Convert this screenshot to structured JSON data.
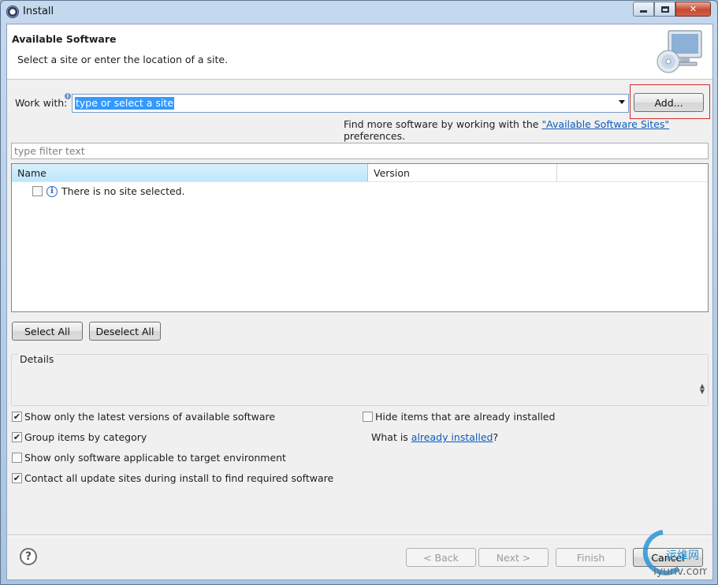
{
  "window": {
    "title": "Install",
    "controls": {
      "minimize": "minimize-icon",
      "maximize": "maximize-icon",
      "close": "close-icon"
    }
  },
  "header": {
    "title": "Available Software",
    "subtitle": "Select a site or enter the location of a site."
  },
  "work_with": {
    "label": "Work with:",
    "value": "type or select a site",
    "add_label": "Add..."
  },
  "find_more": {
    "prefix": "Find more software by working with the ",
    "link": "\"Available Software Sites\"",
    "suffix": " preferences."
  },
  "filter": {
    "placeholder": "type filter text"
  },
  "table": {
    "columns": [
      "Name",
      "Version"
    ],
    "rows": [
      {
        "label": "There is no site selected.",
        "checked": false
      }
    ]
  },
  "buttons": {
    "select_all": "Select All",
    "deselect_all": "Deselect All",
    "back": "< Back",
    "next": "Next >",
    "finish": "Finish",
    "cancel": "Cancel"
  },
  "details": {
    "label": "Details"
  },
  "options": {
    "left": [
      {
        "label": "Show only the latest versions of available software",
        "checked": true
      },
      {
        "label": "Group items by category",
        "checked": true
      },
      {
        "label": "Show only software applicable to target environment",
        "checked": false
      },
      {
        "label": "Contact all update sites during install to find required software",
        "checked": true
      }
    ],
    "hide_installed": {
      "label": "Hide items that are already installed",
      "checked": false
    },
    "what_is": {
      "prefix": "What is ",
      "link": "already installed",
      "suffix": "?"
    }
  },
  "help": "?",
  "watermark": {
    "brand": "运维网",
    "url": "iyunv.com"
  },
  "colors": {
    "selection": "#3399ff",
    "link": "#0b5bbd",
    "highlight_border": "#d22a2a",
    "header_sorted": "#bee6fd"
  }
}
